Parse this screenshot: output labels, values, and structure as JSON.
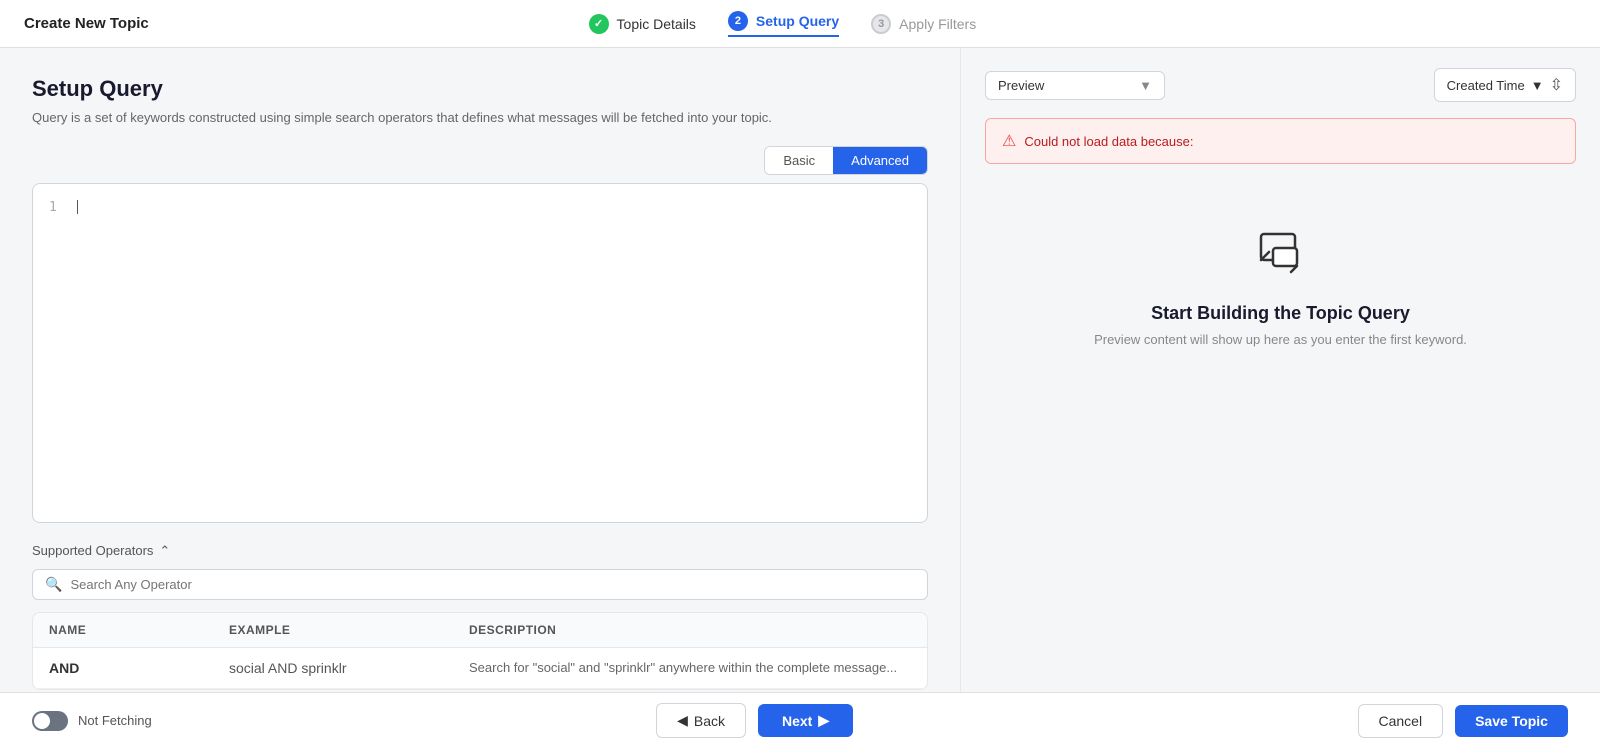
{
  "header": {
    "title": "Create New Topic",
    "steps": [
      {
        "id": "topic-details",
        "label": "Topic Details",
        "state": "done"
      },
      {
        "id": "setup-query",
        "label": "Setup Query",
        "state": "active"
      },
      {
        "id": "apply-filters",
        "label": "Apply Filters",
        "state": "pending"
      }
    ]
  },
  "left": {
    "section_title": "Setup Query",
    "section_desc": "Query is a set of keywords constructed using simple search operators\nthat defines what messages will be fetched into your topic.",
    "query_modes": [
      {
        "id": "basic",
        "label": "Basic"
      },
      {
        "id": "advanced",
        "label": "Advanced"
      }
    ],
    "active_mode": "advanced",
    "editor_line": "1",
    "supported_ops_label": "Supported Operators",
    "search_placeholder": "Search Any Operator",
    "table_headers": [
      "Name",
      "Example",
      "Description"
    ],
    "operators": [
      {
        "name": "AND",
        "example": "social AND sprinklr",
        "description": "Search for \"social\" and \"sprinklr\" anywhere within the complete message..."
      }
    ]
  },
  "right": {
    "preview_label": "Preview",
    "sort_label": "Created Time",
    "error_text": "Could not load data because:",
    "empty_title": "Start Building the Topic Query",
    "empty_desc": "Preview content will show up here as you enter the first keyword."
  },
  "footer": {
    "toggle_label": "Not Fetching",
    "back_label": "Back",
    "next_label": "Next",
    "cancel_label": "Cancel",
    "save_label": "Save Topic"
  }
}
